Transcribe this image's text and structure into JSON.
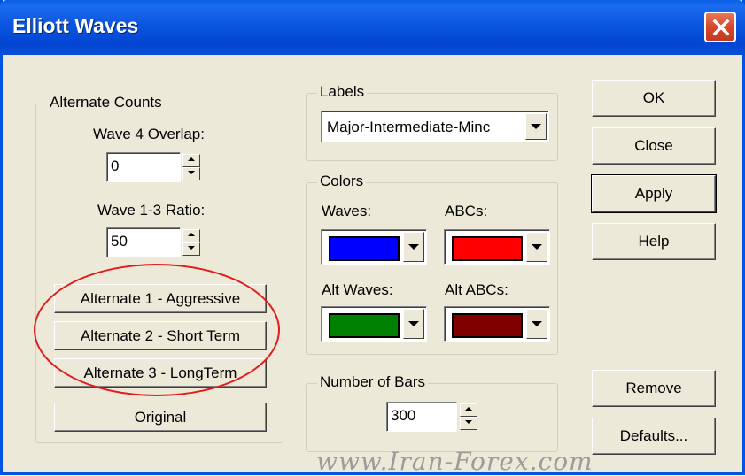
{
  "window": {
    "title": "Elliott Waves",
    "close_icon": "close-icon",
    "accent_color": "#0054E3"
  },
  "alternate_counts": {
    "legend": "Alternate Counts",
    "wave4_label": "Wave 4 Overlap:",
    "wave4_value": "0",
    "wave13_label": "Wave 1-3 Ratio:",
    "wave13_value": "50",
    "buttons": [
      "Alternate 1 - Aggressive",
      "Alternate 2 - Short Term",
      "Alternate 3 - LongTerm",
      "Original"
    ]
  },
  "labels_group": {
    "legend": "Labels",
    "selected": "Major-Intermediate-Minc"
  },
  "colors_group": {
    "legend": "Colors",
    "waves_label": "Waves:",
    "abcs_label": "ABCs:",
    "alt_waves_label": "Alt Waves:",
    "alt_abcs_label": "Alt ABCs:",
    "waves_color": "#0000FF",
    "abcs_color": "#FF0000",
    "alt_waves_color": "#008000",
    "alt_abcs_color": "#800000"
  },
  "bars_group": {
    "legend": "Number of Bars",
    "value": "300"
  },
  "right_buttons": {
    "ok": "OK",
    "close": "Close",
    "apply": "Apply",
    "help": "Help",
    "remove": "Remove",
    "defaults": "Defaults..."
  },
  "watermark": "www.Iran-Forex.com"
}
